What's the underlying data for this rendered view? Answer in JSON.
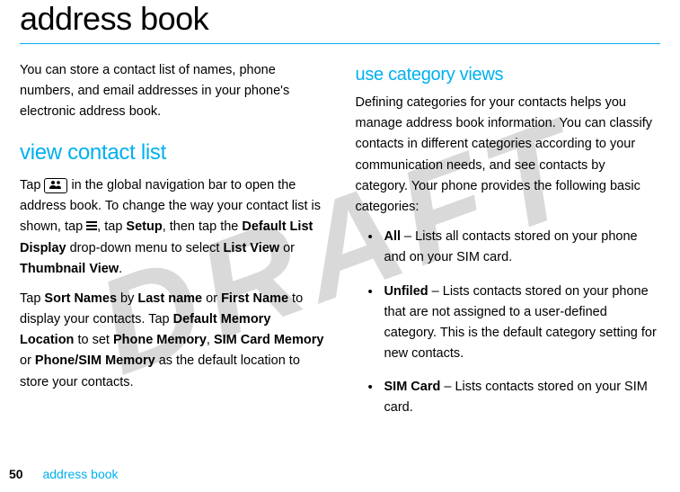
{
  "watermark": "DRAFT",
  "title": "address book",
  "intro": "You can store a contact list of names, phone numbers, and email addresses in your phone's electronic address book.",
  "section1": {
    "heading": "view contact list",
    "p1_pre": "Tap ",
    "p1_post": " in the global navigation bar to open the address book. To change the way your contact list is shown, tap ",
    "p1_tap": ", tap ",
    "setup": "Setup",
    "p1_then": ", then tap the ",
    "default_list_display": "Default List Display",
    "p1_dropdown": " drop-down menu to select ",
    "list_view": "List View",
    "or1": " or ",
    "thumbnail_view": "Thumbnail View",
    "period1": ".",
    "p2_tap": "Tap ",
    "sort_names": "Sort Names",
    "by": " by ",
    "last_name": "Last name",
    "or2": " or ",
    "first_name": "First Name",
    "p2_display": " to display your contacts. Tap ",
    "default_memory_location": "Default Memory Location",
    "p2_toset": " to set ",
    "phone_memory": "Phone Memory",
    "comma": ", ",
    "sim_card_memory": "SIM Card Memory",
    "or3": " or ",
    "phone_sim_memory": "Phone/SIM Memory",
    "p2_end": " as the default location to store your contacts."
  },
  "section2": {
    "heading": "use category views",
    "intro": "Defining categories for your contacts helps you manage address book information. You can classify contacts in different categories according to your communication needs, and see contacts by category. Your phone provides the following basic categories:",
    "items": [
      {
        "label": "All",
        "text": " – Lists all contacts stored on your phone and on your SIM card."
      },
      {
        "label": "Unfiled",
        "text": " – Lists contacts stored on your phone that are not assigned to a user-defined category. This is the default category setting for new contacts."
      },
      {
        "label": "SIM Card",
        "text": " – Lists contacts stored on your SIM card."
      }
    ]
  },
  "footer": {
    "page": "50",
    "crumb": "address book"
  }
}
